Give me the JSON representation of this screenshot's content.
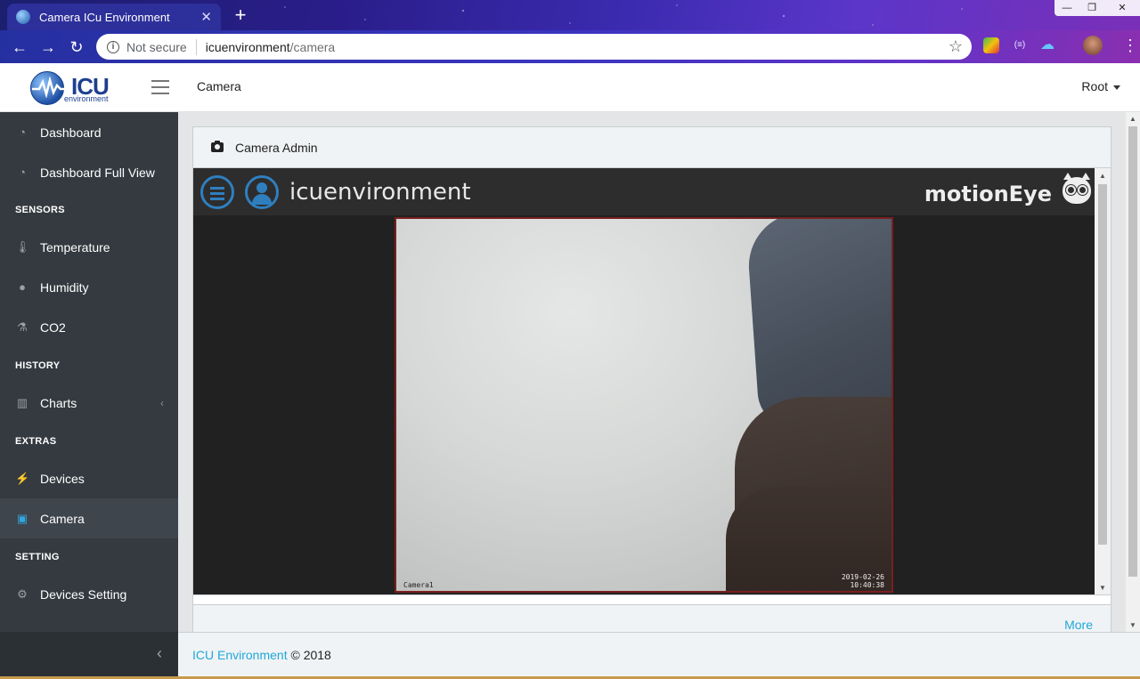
{
  "browser": {
    "tab_title": "Camera ICu Environment",
    "tab_close": "✕",
    "new_tab": "+",
    "security_label": "Not secure",
    "url_host": "icuenvironment",
    "url_path": "/camera",
    "window_controls": [
      "—",
      "❐",
      "✕"
    ]
  },
  "header": {
    "logo_main": "ICU",
    "logo_sub": "environment",
    "title": "Camera",
    "user": "Root"
  },
  "sidebar": {
    "items": [
      {
        "label": "Dashboard",
        "icon": "gauge-icon"
      },
      {
        "label": "Dashboard Full View",
        "icon": "gauge-icon"
      }
    ],
    "sections": [
      {
        "title": "SENSORS",
        "items": [
          {
            "label": "Temperature",
            "icon": "thermometer-icon"
          },
          {
            "label": "Humidity",
            "icon": "droplet-icon"
          },
          {
            "label": "CO2",
            "icon": "flask-icon"
          }
        ]
      },
      {
        "title": "HISTORY",
        "items": [
          {
            "label": "Charts",
            "icon": "bar-chart-icon"
          }
        ]
      },
      {
        "title": "EXTRAS",
        "items": [
          {
            "label": "Devices",
            "icon": "plug-icon"
          },
          {
            "label": "Camera",
            "icon": "camera-icon"
          }
        ]
      },
      {
        "title": "SETTING",
        "items": [
          {
            "label": "Devices Setting",
            "icon": "gear-icon"
          }
        ]
      }
    ],
    "active_item": "Camera"
  },
  "card": {
    "title": "Camera Admin",
    "more_link": "More"
  },
  "motioneye": {
    "name": "icuenvironment",
    "brand": "motionEye",
    "camera_label": "Camera1",
    "timestamp_date": "2019-02-26",
    "timestamp_time": "10:40:38"
  },
  "footer": {
    "link": "ICU Environment",
    "copyright": "© 2018"
  },
  "colors": {
    "sidebar_bg": "#343a40",
    "accent": "#20a8d8",
    "motioneye_blue": "#2f7fbf"
  }
}
